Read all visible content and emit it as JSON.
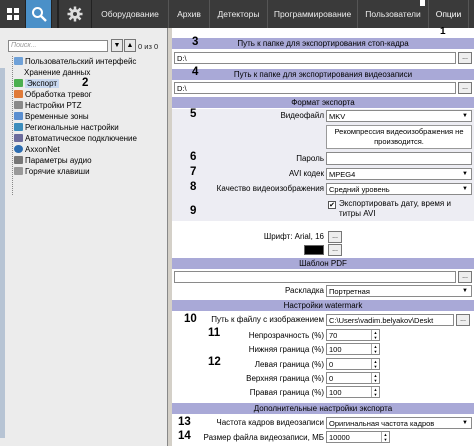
{
  "topbar": {
    "tabs": [
      "Оборудование",
      "Архив",
      "Детекторы",
      "Программирование",
      "Пользователи",
      "Опции"
    ],
    "active_tab": "Опции"
  },
  "left": {
    "search_placeholder": "Поиск...",
    "count_text": "0 из 0",
    "items": [
      "Пользовательский интерфейс",
      "Хранение данных",
      "Экспорт",
      "Обработка тревог",
      "Настройки PTZ",
      "Временные зоны",
      "Региональные настройки",
      "Автоматическое подключение",
      "AxxonNet",
      "Параметры аудио",
      "Горячие клавиши"
    ],
    "selected_item": "Экспорт",
    "step_number": "2"
  },
  "form": {
    "snapshot_path": {
      "num": "3",
      "header": "Путь к папке для экспортирования стоп-кадра",
      "value": "D:\\",
      "btn": "..."
    },
    "video_path": {
      "num": "4",
      "header": "Путь к папке для экспортирования видеозаписи",
      "value": "D:\\",
      "btn": "..."
    },
    "export_format_header": "Формат экспорта",
    "video_file": {
      "num": "5",
      "label": "Видеофайл",
      "value": "MKV"
    },
    "recompress_note": "Рекомпрессия видеоизображения не производится.",
    "password": {
      "num": "6",
      "label": "Пароль",
      "value": ""
    },
    "avi_codec": {
      "num": "7",
      "label": "AVI кодек",
      "value": "MPEG4"
    },
    "video_quality": {
      "num": "8",
      "label": "Качество видеоизображения",
      "value": "Средний уровень"
    },
    "export_datetime": {
      "num": "9",
      "label": "Экспортировать дату, время и титры AVI",
      "checked": true
    },
    "font": {
      "label": "Шрифт: Arial, 16",
      "btn": "...",
      "color_btn": "..."
    },
    "pdf_header": "Шаблон PDF",
    "pdf_btn": "...",
    "layout": {
      "label": "Раскладка",
      "value": "Портретная"
    },
    "watermark_header": "Настройки watermark",
    "image_path": {
      "num": "10",
      "label": "Путь к файлу с изображением",
      "value": "C:\\Users\\vadim.belyakov\\Deskt",
      "btn": "..."
    },
    "opacity": {
      "num": "11",
      "label": "Непрозрачность (%)",
      "value": "70"
    },
    "bottom_border": {
      "label": "Нижняя граница (%)",
      "value": "100"
    },
    "left_border": {
      "num": "12",
      "label": "Левая граница (%)",
      "value": "0"
    },
    "top_border": {
      "label": "Верхняя граница (%)",
      "value": "0"
    },
    "right_border": {
      "label": "Правая граница (%)",
      "value": "100"
    },
    "extra_header": "Дополнительные настройки экспорта",
    "frame_rate": {
      "num": "13",
      "label": "Частота кадров видеозаписи",
      "value": "Оригинальная частота кадров"
    },
    "max_size": {
      "num": "14",
      "label": "Размер файла видеозаписи, МБ",
      "value": "10000"
    },
    "opts_number": "1",
    "colors": {
      "header": "#a9a9d7",
      "topbar": "#3a3a3a",
      "selected_icon": "#4a90c8"
    }
  }
}
